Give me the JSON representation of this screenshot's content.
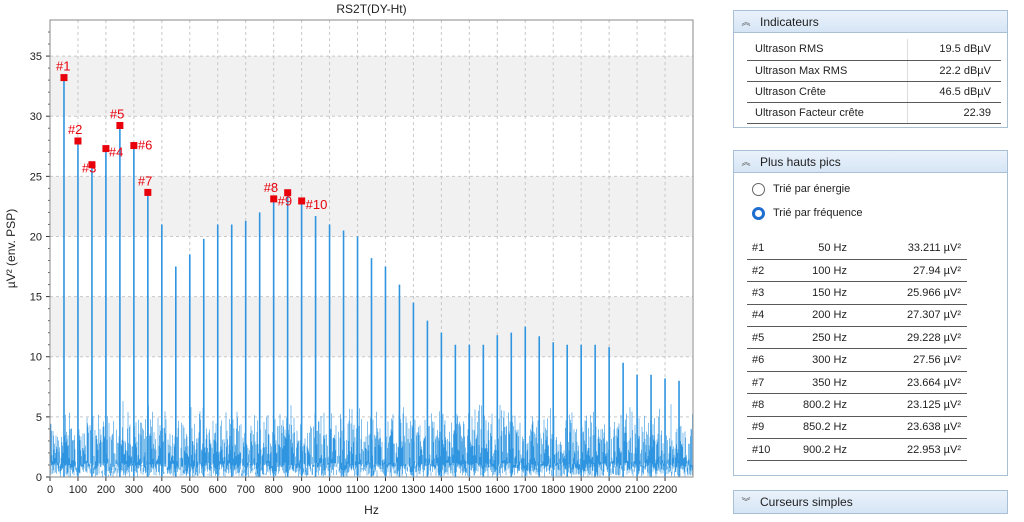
{
  "chart_data": {
    "type": "line",
    "title": "RS2T(DY-Ht)",
    "xlabel": "Hz",
    "ylabel": "µV² (env. PSP)",
    "xlim": [
      0,
      2300
    ],
    "ylim": [
      0,
      38
    ],
    "xticks": [
      0,
      100,
      200,
      300,
      400,
      500,
      600,
      700,
      800,
      900,
      1000,
      1100,
      1200,
      1300,
      1400,
      1500,
      1600,
      1700,
      1800,
      1900,
      2000,
      2100,
      2200
    ],
    "yticks": [
      0,
      5,
      10,
      15,
      20,
      25,
      30,
      35
    ],
    "grid": true,
    "color": "#2f95e0",
    "noise_floor": {
      "x_range": [
        0,
        2300
      ],
      "typical": [
        0,
        5.5
      ]
    },
    "peaks_series": [
      {
        "x": 50,
        "y": 33.2
      },
      {
        "x": 100,
        "y": 27.9
      },
      {
        "x": 150,
        "y": 26.0
      },
      {
        "x": 200,
        "y": 27.3
      },
      {
        "x": 250,
        "y": 29.2
      },
      {
        "x": 300,
        "y": 27.6
      },
      {
        "x": 350,
        "y": 23.7
      },
      {
        "x": 400,
        "y": 21.0
      },
      {
        "x": 450,
        "y": 17.5
      },
      {
        "x": 500,
        "y": 18.5
      },
      {
        "x": 550,
        "y": 19.8
      },
      {
        "x": 600,
        "y": 21.0
      },
      {
        "x": 650,
        "y": 21.0
      },
      {
        "x": 700,
        "y": 21.3
      },
      {
        "x": 750,
        "y": 22.0
      },
      {
        "x": 800,
        "y": 23.1
      },
      {
        "x": 850,
        "y": 23.6
      },
      {
        "x": 900,
        "y": 23.0
      },
      {
        "x": 950,
        "y": 21.7
      },
      {
        "x": 1000,
        "y": 21.0
      },
      {
        "x": 1050,
        "y": 20.5
      },
      {
        "x": 1100,
        "y": 20.0
      },
      {
        "x": 1150,
        "y": 18.2
      },
      {
        "x": 1200,
        "y": 17.5
      },
      {
        "x": 1250,
        "y": 16.0
      },
      {
        "x": 1300,
        "y": 14.5
      },
      {
        "x": 1350,
        "y": 13.0
      },
      {
        "x": 1400,
        "y": 12.0
      },
      {
        "x": 1450,
        "y": 11.0
      },
      {
        "x": 1500,
        "y": 11.0
      },
      {
        "x": 1550,
        "y": 11.0
      },
      {
        "x": 1600,
        "y": 11.8
      },
      {
        "x": 1650,
        "y": 12.0
      },
      {
        "x": 1700,
        "y": 12.5
      },
      {
        "x": 1750,
        "y": 11.7
      },
      {
        "x": 1800,
        "y": 11.2
      },
      {
        "x": 1850,
        "y": 11.0
      },
      {
        "x": 1900,
        "y": 11.0
      },
      {
        "x": 1950,
        "y": 11.0
      },
      {
        "x": 2000,
        "y": 10.8
      },
      {
        "x": 2050,
        "y": 9.5
      },
      {
        "x": 2100,
        "y": 8.5
      },
      {
        "x": 2150,
        "y": 8.5
      },
      {
        "x": 2200,
        "y": 8.2
      },
      {
        "x": 2250,
        "y": 8.0
      }
    ],
    "annotations": [
      {
        "label": "#1",
        "x": 50,
        "y": 33.211
      },
      {
        "label": "#2",
        "x": 100,
        "y": 27.94
      },
      {
        "label": "#3",
        "x": 150,
        "y": 25.966
      },
      {
        "label": "#4",
        "x": 200,
        "y": 27.307
      },
      {
        "label": "#5",
        "x": 250,
        "y": 29.228
      },
      {
        "label": "#6",
        "x": 300,
        "y": 27.56
      },
      {
        "label": "#7",
        "x": 350,
        "y": 23.664
      },
      {
        "label": "#8",
        "x": 800.2,
        "y": 23.125
      },
      {
        "label": "#9",
        "x": 850.2,
        "y": 23.638
      },
      {
        "label": "#10",
        "x": 900.2,
        "y": 22.953
      }
    ],
    "marker_color": "#e8000b"
  },
  "indicators": {
    "title": "Indicateurs",
    "rows": [
      {
        "label": "Ultrason RMS",
        "value": "19.5 dBµV"
      },
      {
        "label": "Ultrason Max RMS",
        "value": "22.2 dBµV"
      },
      {
        "label": "Ultrason Crête",
        "value": "46.5 dBµV"
      },
      {
        "label": "Ultrason Facteur crête",
        "value": "22.39"
      }
    ]
  },
  "peaks_panel": {
    "title": "Plus hauts pics",
    "sort_energy": "Trié par énergie",
    "sort_frequency": "Trié par fréquence",
    "rows": [
      {
        "idx": "#1",
        "freq": "50 Hz",
        "amp": "33.211 µV²"
      },
      {
        "idx": "#2",
        "freq": "100 Hz",
        "amp": "27.94 µV²"
      },
      {
        "idx": "#3",
        "freq": "150 Hz",
        "amp": "25.966 µV²"
      },
      {
        "idx": "#4",
        "freq": "200 Hz",
        "amp": "27.307 µV²"
      },
      {
        "idx": "#5",
        "freq": "250 Hz",
        "amp": "29.228 µV²"
      },
      {
        "idx": "#6",
        "freq": "300 Hz",
        "amp": "27.56 µV²"
      },
      {
        "idx": "#7",
        "freq": "350 Hz",
        "amp": "23.664 µV²"
      },
      {
        "idx": "#8",
        "freq": "800.2 Hz",
        "amp": "23.125 µV²"
      },
      {
        "idx": "#9",
        "freq": "850.2 Hz",
        "amp": "23.638 µV²"
      },
      {
        "idx": "#10",
        "freq": "900.2 Hz",
        "amp": "22.953 µV²"
      }
    ]
  },
  "cursors_panel": {
    "title": "Curseurs simples"
  }
}
